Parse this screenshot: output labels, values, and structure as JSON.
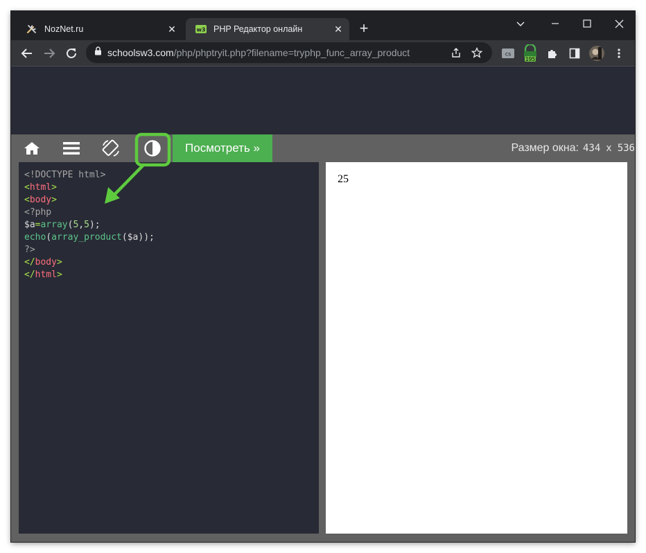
{
  "browser": {
    "tabs": [
      {
        "title": "NozNet.ru",
        "favicon": "tools-icon",
        "active": false
      },
      {
        "title": "PHP Редактор онлайн",
        "favicon": "w3schools-icon",
        "active": true
      }
    ],
    "address": {
      "host": "schoolsw3.com",
      "path": "/php/phptryit.php?filename=tryphp_func_array_product"
    },
    "extension_badge": "195"
  },
  "w3_toolbar": {
    "run_button": "Посмотреть »",
    "size_label": "Размер окна:",
    "width": "434",
    "times": "x",
    "height": "536"
  },
  "code_lines": [
    {
      "parts": [
        {
          "text": "<!DOCTYPE html>",
          "cls": "c-gray"
        }
      ]
    },
    {
      "parts": [
        {
          "text": "<",
          "cls": "c-punct"
        },
        {
          "text": "html",
          "cls": "c-tag"
        },
        {
          "text": ">",
          "cls": "c-punct"
        }
      ]
    },
    {
      "parts": [
        {
          "text": "<",
          "cls": "c-punct"
        },
        {
          "text": "body",
          "cls": "c-tag"
        },
        {
          "text": ">",
          "cls": "c-punct"
        }
      ]
    },
    {
      "parts": [
        {
          "text": "<?php",
          "cls": "c-gray"
        }
      ]
    },
    {
      "parts": [
        {
          "text": "$a",
          "cls": "c-plain"
        },
        {
          "text": "=",
          "cls": "c-punct"
        },
        {
          "text": "array",
          "cls": "c-fn"
        },
        {
          "text": "(",
          "cls": "c-plain"
        },
        {
          "text": "5",
          "cls": "c-num"
        },
        {
          "text": ",",
          "cls": "c-plain"
        },
        {
          "text": "5",
          "cls": "c-num"
        },
        {
          "text": ");",
          "cls": "c-plain"
        }
      ]
    },
    {
      "parts": [
        {
          "text": "echo",
          "cls": "c-fn"
        },
        {
          "text": "(",
          "cls": "c-plain"
        },
        {
          "text": "array_product",
          "cls": "c-fn"
        },
        {
          "text": "(",
          "cls": "c-plain"
        },
        {
          "text": "$a",
          "cls": "c-plain"
        },
        {
          "text": "));",
          "cls": "c-plain"
        }
      ]
    },
    {
      "parts": [
        {
          "text": "?>",
          "cls": "c-gray"
        }
      ]
    },
    {
      "parts": [
        {
          "text": "</",
          "cls": "c-punct"
        },
        {
          "text": "body",
          "cls": "c-tag"
        },
        {
          "text": ">",
          "cls": "c-punct"
        }
      ]
    },
    {
      "parts": [
        {
          "text": "</",
          "cls": "c-punct"
        },
        {
          "text": "html",
          "cls": "c-tag"
        },
        {
          "text": ">",
          "cls": "c-punct"
        }
      ]
    }
  ],
  "output": "25",
  "colors": {
    "highlight": "#5ecb3f",
    "run_button": "#4caf50",
    "editor_bg": "#282a35"
  }
}
